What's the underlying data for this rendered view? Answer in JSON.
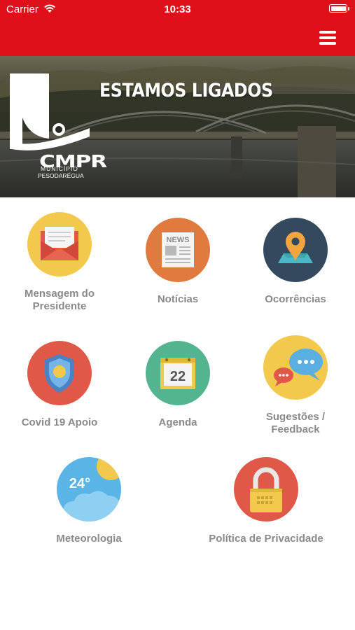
{
  "status_bar": {
    "carrier": "Carrier",
    "time": "10:33"
  },
  "banner": {
    "title": "ESTAMOS LIGADOS",
    "logo_text": "CMPR",
    "logo_sub1": "MUNICÍPIO",
    "logo_sub2": "PESODARÉGUA"
  },
  "colors": {
    "brand_red": "#e0101a",
    "label_gray": "#8a8a8a"
  },
  "tiles": [
    {
      "label": "Mensagem do\nPresidente",
      "icon": "envelope-icon"
    },
    {
      "label": "Notícias",
      "icon": "newspaper-icon",
      "icon_text": "NEWS"
    },
    {
      "label": "Ocorrências",
      "icon": "map-pin-icon"
    },
    {
      "label": "Covid 19 Apoio",
      "icon": "shield-icon"
    },
    {
      "label": "Agenda",
      "icon": "calendar-icon",
      "icon_text": "22"
    },
    {
      "label": "Sugestões /\nFeedback",
      "icon": "chat-bubbles-icon"
    },
    {
      "label": "Meteorologia",
      "icon": "weather-icon",
      "icon_text": "24°"
    },
    {
      "label": "Política de Privacidade",
      "icon": "padlock-icon"
    }
  ]
}
